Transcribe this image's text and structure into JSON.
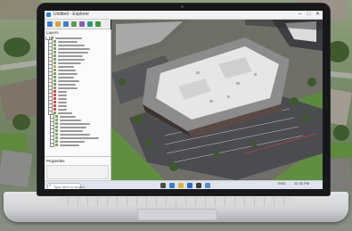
{
  "window": {
    "title": "Untitled - Explorer",
    "controls": {
      "minimize": "–",
      "maximize": "□",
      "close": "✕"
    }
  },
  "left_panel": {
    "header": "Layers",
    "tree_rows": [
      {
        "icon_color": "#7aa35c",
        "w": 30
      },
      {
        "icon_color": "#7aa35c",
        "w": 22
      },
      {
        "icon_color": "#7aa35c",
        "w": 30
      },
      {
        "icon_color": "#7aa35c",
        "w": 36
      },
      {
        "icon_color": "#7aa35c",
        "w": 34
      },
      {
        "icon_color": "#7aa35c",
        "w": 28
      },
      {
        "icon_color": "#7aa35c",
        "w": 30
      },
      {
        "icon_color": "#7aa35c",
        "w": 26
      },
      {
        "icon_color": "#c8a24a",
        "w": 18
      },
      {
        "icon_color": "#7aa35c",
        "w": 20
      },
      {
        "icon_color": "#7aa35c",
        "w": 22
      },
      {
        "icon_color": "#7aa35c",
        "w": 18
      },
      {
        "icon_color": "#7aa35c",
        "w": 24
      },
      {
        "icon_color": "#7aa35c",
        "w": 20
      },
      {
        "icon_color": "#7aa35c",
        "w": 22
      },
      {
        "icon_color": "#d6443b",
        "w": 10
      },
      {
        "icon_color": "#d6443b",
        "w": 10
      },
      {
        "icon_color": "#d6443b",
        "w": 10
      },
      {
        "icon_color": "#d6443b",
        "w": 10
      },
      {
        "icon_color": "#d6443b",
        "w": 10
      },
      {
        "icon_color": "#d6443b",
        "w": 10
      },
      {
        "icon_color": "#7aa35c",
        "w": 16
      },
      {
        "icon_color": "#7aa35c",
        "w": 18
      },
      {
        "icon_color": "#7aa35c",
        "w": 24
      },
      {
        "icon_color": "#7aa35c",
        "w": 34
      },
      {
        "icon_color": "#7aa35c",
        "w": 30
      },
      {
        "icon_color": "#7aa35c",
        "w": 26
      },
      {
        "icon_color": "#7aa35c",
        "w": 34
      },
      {
        "icon_color": "#7aa35c",
        "w": 44
      },
      {
        "icon_color": "#7aa35c",
        "w": 28
      },
      {
        "icon_color": "#7aa35c",
        "w": 22
      }
    ],
    "footer": "Properties"
  },
  "toolbar": {
    "buttons": [
      {
        "name": "new-icon",
        "color": "#3d7fcf"
      },
      {
        "name": "open-icon",
        "color": "#d9a43b"
      },
      {
        "name": "save-icon",
        "color": "#3d7fcf"
      },
      {
        "name": "layer-icon",
        "color": "#5aa04a"
      },
      {
        "name": "settings-icon",
        "color": "#8a5bbf"
      },
      {
        "name": "refresh-icon",
        "color": "#2c9a8a"
      },
      {
        "name": "play-icon",
        "color": "#3a9c3a"
      }
    ]
  },
  "taskbar": {
    "search_placeholder": "Type here to search",
    "apps": [
      {
        "name": "task-view-icon",
        "color": "#4a4a4a"
      },
      {
        "name": "browser-icon",
        "color": "#2f7fd6"
      },
      {
        "name": "file-explorer-icon",
        "color": "#e2b33a"
      },
      {
        "name": "mail-icon",
        "color": "#2a6fc2"
      },
      {
        "name": "store-icon",
        "color": "#3c3c3c"
      },
      {
        "name": "app-icon",
        "color": "#4d8fd8"
      }
    ],
    "tray_text": "ENG",
    "clock": "12:30 PM"
  },
  "colors": {
    "accent": "#2a7fd4",
    "roof": "#e7e7e7",
    "parking": "#4a4c50",
    "grass": "#5f8f3e",
    "stripe": "#c33e3e"
  }
}
